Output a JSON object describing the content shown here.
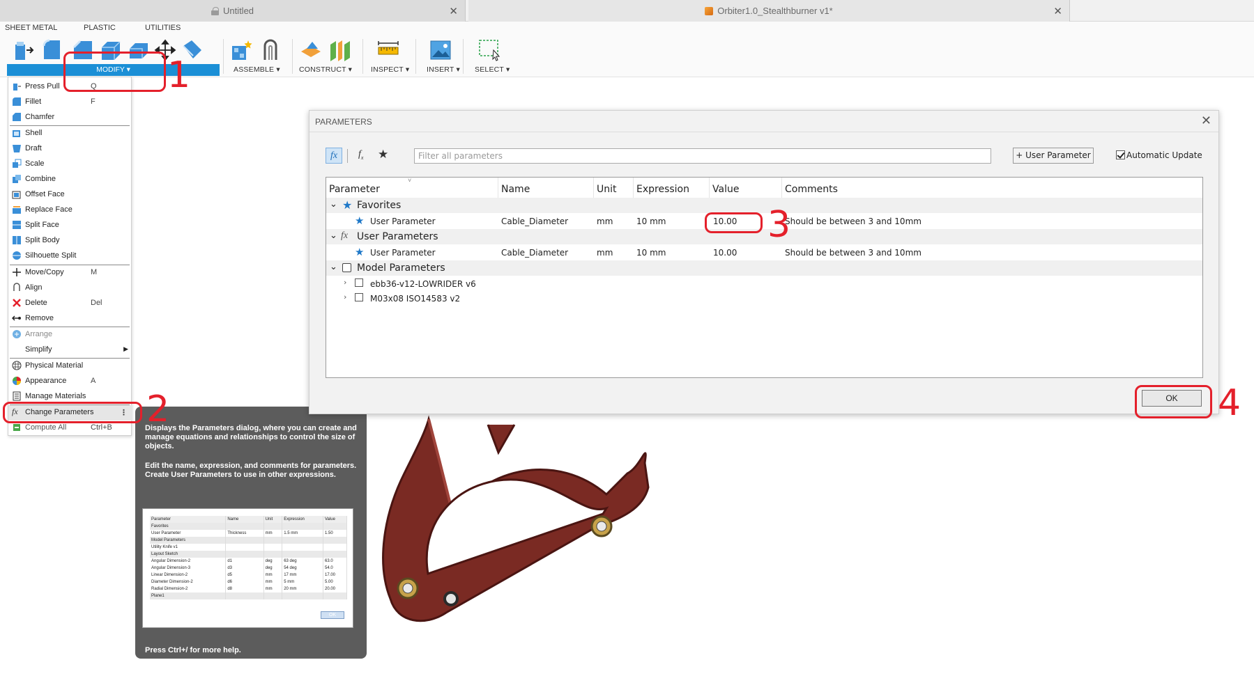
{
  "tabs": [
    {
      "label": "Untitled",
      "icon": "lock-icon"
    },
    {
      "label": "Orbiter1.0_Stealthburner v1*",
      "icon": "cube-icon"
    }
  ],
  "toolbar": {
    "categories": [
      "SHEET METAL",
      "PLASTIC",
      "UTILITIES"
    ],
    "groups": {
      "modify": "MODIFY ▾",
      "assemble": "ASSEMBLE ▾",
      "construct": "CONSTRUCT ▾",
      "inspect": "INSPECT ▾",
      "insert": "INSERT ▾",
      "select": "SELECT ▾"
    },
    "accent": "#1b8fd6"
  },
  "menu": {
    "items": [
      {
        "label": "Press Pull",
        "shortcut": "Q",
        "icon": "press-pull-icon"
      },
      {
        "label": "Fillet",
        "shortcut": "F",
        "icon": "fillet-icon"
      },
      {
        "label": "Chamfer",
        "shortcut": "",
        "icon": "chamfer-icon"
      },
      {
        "label": "Shell",
        "shortcut": "",
        "icon": "shell-icon"
      },
      {
        "label": "Draft",
        "shortcut": "",
        "icon": "draft-icon"
      },
      {
        "label": "Scale",
        "shortcut": "",
        "icon": "scale-icon"
      },
      {
        "label": "Combine",
        "shortcut": "",
        "icon": "combine-icon"
      },
      {
        "label": "Offset Face",
        "shortcut": "",
        "icon": "offset-face-icon"
      },
      {
        "label": "Replace Face",
        "shortcut": "",
        "icon": "replace-face-icon"
      },
      {
        "label": "Split Face",
        "shortcut": "",
        "icon": "split-face-icon"
      },
      {
        "label": "Split Body",
        "shortcut": "",
        "icon": "split-body-icon"
      },
      {
        "label": "Silhouette Split",
        "shortcut": "",
        "icon": "silhouette-split-icon"
      },
      {
        "label": "Move/Copy",
        "shortcut": "M",
        "icon": "move-icon"
      },
      {
        "label": "Align",
        "shortcut": "",
        "icon": "align-icon"
      },
      {
        "label": "Delete",
        "shortcut": "Del",
        "icon": "delete-icon"
      },
      {
        "label": "Remove",
        "shortcut": "",
        "icon": "remove-icon"
      },
      {
        "label": "Arrange",
        "shortcut": "",
        "icon": "arrange-icon"
      },
      {
        "label": "Simplify",
        "shortcut": "",
        "icon": "chevron-right-icon"
      },
      {
        "label": "Physical Material",
        "shortcut": "",
        "icon": "physical-material-icon"
      },
      {
        "label": "Appearance",
        "shortcut": "A",
        "icon": "appearance-icon"
      },
      {
        "label": "Manage Materials",
        "shortcut": "",
        "icon": "manage-materials-icon"
      },
      {
        "label": "Change Parameters",
        "shortcut": "⋮",
        "icon": "fx-icon"
      },
      {
        "label": "Compute All",
        "shortcut": "Ctrl+B",
        "icon": "compute-icon"
      }
    ]
  },
  "tooltip": {
    "para1": "Displays the Parameters dialog, where you can create and manage equations and relationships to control the size of objects.",
    "para2": "Edit the name, expression, and comments for parameters. Create User Parameters to use in other expressions.",
    "footer": "Press Ctrl+/ for more help.",
    "preview": {
      "headers": [
        "Parameter",
        "Name",
        "Unit",
        "Expression",
        "Value"
      ],
      "rows": [
        [
          "Favorites",
          "",
          "",
          "",
          ""
        ],
        [
          "User Parameter",
          "Thickness",
          "mm",
          "1.5 mm",
          "1.50"
        ],
        [
          "Model Parameters",
          "",
          "",
          "",
          ""
        ],
        [
          "Utility Knife v1",
          "",
          "",
          "",
          ""
        ],
        [
          "Layout Sketch",
          "",
          "",
          "",
          ""
        ],
        [
          "Angular Dimension-2",
          "d1",
          "deg",
          "63 deg",
          "63.0"
        ],
        [
          "Angular Dimension-3",
          "d3",
          "deg",
          "54 deg",
          "54.0"
        ],
        [
          "Linear Dimension-2",
          "d5",
          "mm",
          "17 mm",
          "17.00"
        ],
        [
          "Diameter Dimension-2",
          "d6",
          "mm",
          "5 mm",
          "5.00"
        ],
        [
          "Radial Dimension-2",
          "d8",
          "mm",
          "20 mm",
          "20.00"
        ],
        [
          "Plane1",
          "",
          "",
          "",
          ""
        ]
      ],
      "ok": "OK"
    }
  },
  "dialog": {
    "title": "PARAMETERS",
    "filter_placeholder": "Filter all parameters",
    "user_param_button": "+ User Parameter",
    "auto_update": "Automatic Update",
    "ok": "OK",
    "columns": [
      "Parameter",
      "Name",
      "Unit",
      "Expression",
      "Value",
      "Comments"
    ],
    "groups": {
      "favorites": "Favorites",
      "user": "User Parameters",
      "model": "Model Parameters"
    },
    "favorite_row": {
      "parameter": "User Parameter",
      "name": "Cable_Diameter",
      "unit": "mm",
      "expression": "10 mm",
      "value": "10.00",
      "comments": "Should be between 3 and 10mm"
    },
    "user_row": {
      "parameter": "User Parameter",
      "name": "Cable_Diameter",
      "unit": "mm",
      "expression": "10 mm",
      "value": "10.00",
      "comments": "Should be between 3 and 10mm"
    },
    "model_rows": [
      "ebb36-v12-LOWRIDER v6",
      "M03x08 ISO14583 v2"
    ]
  },
  "annotations": [
    "1",
    "2",
    "3",
    "4"
  ],
  "model_color": "#7a2a23"
}
